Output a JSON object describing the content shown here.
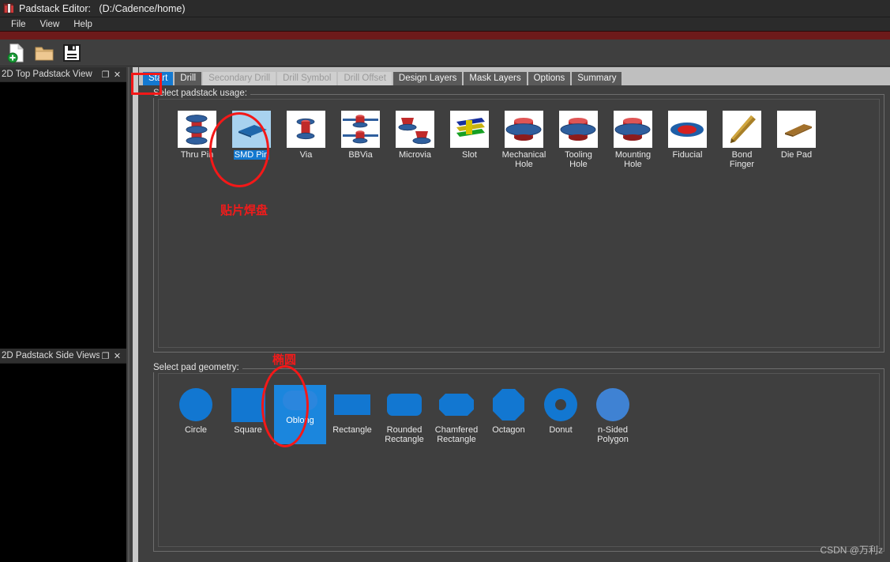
{
  "window": {
    "title": "Padstack Editor:   (D:/Cadence/home)",
    "icon": "padstack-app-icon"
  },
  "menubar": {
    "items": [
      "File",
      "View",
      "Help"
    ]
  },
  "toolbar": {
    "buttons": [
      {
        "name": "new-file-icon",
        "tooltip": "New"
      },
      {
        "name": "open-folder-icon",
        "tooltip": "Open"
      },
      {
        "name": "save-icon",
        "tooltip": "Save"
      }
    ]
  },
  "left_dock": {
    "panels": [
      {
        "title": "2D Top Padstack View",
        "float_label": "❐",
        "close_label": "✕"
      },
      {
        "title": "2D Padstack Side Views",
        "float_label": "❐",
        "close_label": "✕"
      }
    ]
  },
  "tabs": [
    {
      "label": "Start",
      "state": "selected"
    },
    {
      "label": "Drill",
      "state": "normal"
    },
    {
      "label": "Secondary Drill",
      "state": "disabled"
    },
    {
      "label": "Drill Symbol",
      "state": "disabled"
    },
    {
      "label": "Drill Offset",
      "state": "disabled"
    },
    {
      "label": "Design Layers",
      "state": "normal"
    },
    {
      "label": "Mask Layers",
      "state": "normal"
    },
    {
      "label": "Options",
      "state": "normal"
    },
    {
      "label": "Summary",
      "state": "normal"
    }
  ],
  "usage_group": {
    "label": "Select padstack usage:",
    "items": [
      {
        "label": "Thru Pin",
        "icon": "thru-pin-icon",
        "selected": false
      },
      {
        "label": "SMD Pin",
        "icon": "smd-pin-icon",
        "selected": true
      },
      {
        "label": "Via",
        "icon": "via-icon",
        "selected": false
      },
      {
        "label": "BBVia",
        "icon": "bbvia-icon",
        "selected": false
      },
      {
        "label": "Microvia",
        "icon": "microvia-icon",
        "selected": false
      },
      {
        "label": "Slot",
        "icon": "slot-icon",
        "selected": false
      },
      {
        "label": "Mechanical\nHole",
        "icon": "mechanical-hole-icon",
        "selected": false
      },
      {
        "label": "Tooling\nHole",
        "icon": "tooling-hole-icon",
        "selected": false
      },
      {
        "label": "Mounting\nHole",
        "icon": "mounting-hole-icon",
        "selected": false
      },
      {
        "label": "Fiducial",
        "icon": "fiducial-icon",
        "selected": false
      },
      {
        "label": "Bond\nFinger",
        "icon": "bond-finger-icon",
        "selected": false
      },
      {
        "label": "Die Pad",
        "icon": "die-pad-icon",
        "selected": false
      }
    ]
  },
  "geometry_group": {
    "label": "Select pad geometry:",
    "items": [
      {
        "label": "Circle",
        "shape": "circle",
        "selected": false
      },
      {
        "label": "Square",
        "shape": "square",
        "selected": false
      },
      {
        "label": "Oblong",
        "shape": "oblong",
        "selected": true
      },
      {
        "label": "Rectangle",
        "shape": "rectangle",
        "selected": false
      },
      {
        "label": "Rounded\nRectangle",
        "shape": "rounded-rectangle",
        "selected": false
      },
      {
        "label": "Chamfered\nRectangle",
        "shape": "chamfered-rectangle",
        "selected": false
      },
      {
        "label": "Octagon",
        "shape": "octagon",
        "selected": false
      },
      {
        "label": "Donut",
        "shape": "donut",
        "selected": false
      },
      {
        "label": "n-Sided\nPolygon",
        "shape": "n-sided-polygon",
        "selected": false
      }
    ]
  },
  "annotations": [
    {
      "name": "smd-pin-annotation-text",
      "text": "贴片焊盘"
    },
    {
      "name": "oblong-annotation-text",
      "text": "椭圆"
    }
  ],
  "watermark": {
    "text": "CSDN @万利z"
  },
  "colors": {
    "accent_blue": "#1479d0",
    "annotation_red": "#f41818",
    "pad_blue": "#1277d1",
    "window_bg": "#3f3f3f",
    "titlebar_bg": "#2b2b2b",
    "tabstrip_bg": "#bfbfbf"
  }
}
